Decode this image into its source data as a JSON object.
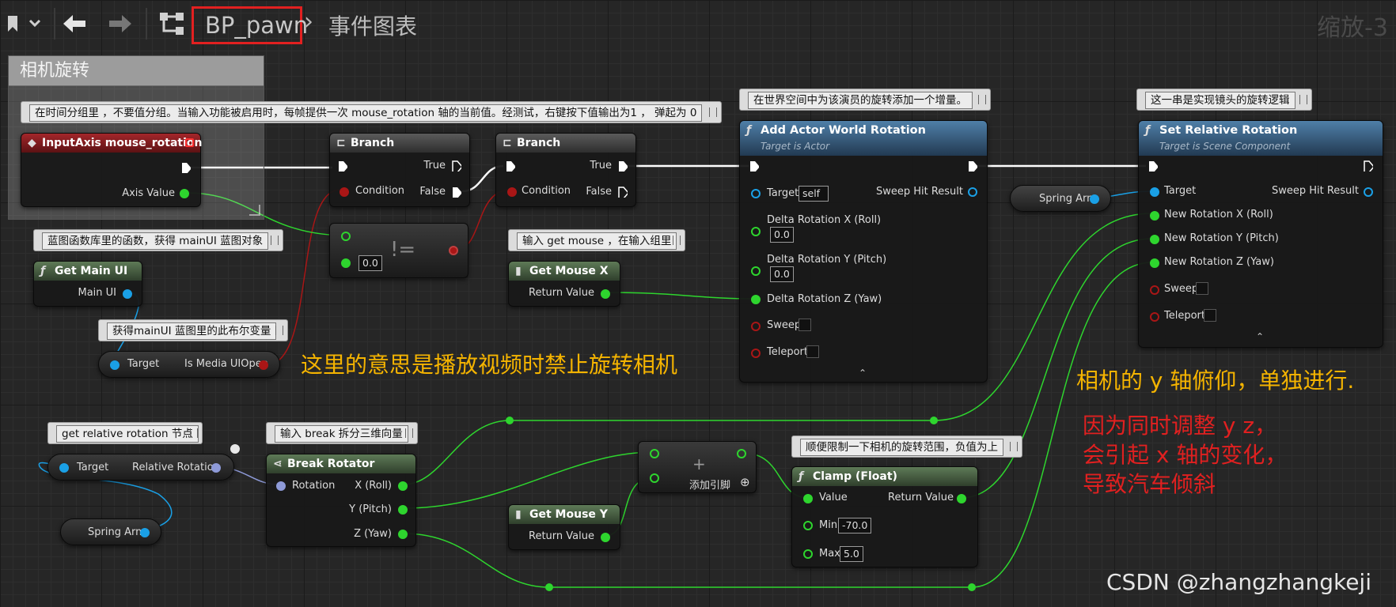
{
  "toolbar": {
    "graph_name": "BP_pawn",
    "graph_tab": "事件图表",
    "zoom": "缩放-3"
  },
  "comment_box": {
    "title": "相机旋转"
  },
  "comments": {
    "input_axis": "在时间分组里 ，不要值分组。当输入功能被启用时，每帧提供一次 mouse_rotation 轴的当前值。经测试，右键按下值输出为1 ， 弹起为 0",
    "get_main_ui": "蓝图函数库里的函数，获得 mainUI 蓝图对象",
    "is_media": "获得mainUI 蓝图里的此布尔变量",
    "get_mouse": "输入 get mouse ，在输入组里",
    "add_world_rotation": "在世界空间中为该演员的旋转添加一个增量。",
    "set_relative": "这一串是实现镜头的旋转逻辑",
    "get_relative": "get relative rotation 节点",
    "break_rotator": "输入 break 拆分三维向量",
    "clamp": "顺便限制一下相机的旋转范围，负值为上"
  },
  "nodes": {
    "input_axis": {
      "title": "InputAxis mouse_rotation",
      "axis_value": "Axis Value"
    },
    "branch1": {
      "title": "Branch",
      "true": "True",
      "false": "False",
      "condition": "Condition"
    },
    "branch2": {
      "title": "Branch",
      "true": "True",
      "false": "False",
      "condition": "Condition"
    },
    "not_equal": {
      "symbol": "!=",
      "value": "0.0"
    },
    "get_main_ui": {
      "title": "Get Main UI",
      "out": "Main UI"
    },
    "is_media": {
      "target": "Target",
      "out": "Is Media UIOpen"
    },
    "get_mouse_x": {
      "title": "Get Mouse X",
      "out": "Return Value"
    },
    "get_mouse_y": {
      "title": "Get Mouse Y",
      "out": "Return Value"
    },
    "add_world_rotation": {
      "title": "Add Actor World Rotation",
      "subtitle": "Target is Actor",
      "target": "Target",
      "target_value": "self",
      "sweep_hit": "Sweep Hit Result",
      "dx": "Delta Rotation X (Roll)",
      "dx_value": "0.0",
      "dy": "Delta Rotation Y (Pitch)",
      "dy_value": "0.0",
      "dz": "Delta Rotation Z (Yaw)",
      "sweep": "Sweep",
      "teleport": "Teleport"
    },
    "spring_arm_1": {
      "label": "Spring Arm"
    },
    "spring_arm_2": {
      "label": "Spring Arm"
    },
    "set_relative": {
      "title": "Set Relative Rotation",
      "subtitle": "Target is Scene Component",
      "target": "Target",
      "sweep_hit": "Sweep Hit Result",
      "nx": "New Rotation X (Roll)",
      "ny": "New Rotation Y (Pitch)",
      "nz": "New Rotation Z (Yaw)",
      "sweep": "Sweep",
      "teleport": "Teleport"
    },
    "get_relative": {
      "target": "Target",
      "out": "Relative Rotation"
    },
    "break_rotator": {
      "title": "Break Rotator",
      "in": "Rotation",
      "x": "X (Roll)",
      "y": "Y (Pitch)",
      "z": "Z (Yaw)"
    },
    "add": {
      "symbol": "+",
      "add_pin": "添加引脚"
    },
    "clamp": {
      "title": "Clamp (Float)",
      "value": "Value",
      "out": "Return Value",
      "min": "Min",
      "min_value": "-70.0",
      "max": "Max",
      "max_value": "5.0"
    }
  },
  "annotations": {
    "yellow1": "这里的意思是播放视频时禁止旋转相机",
    "yellow2": "相机的 y 轴俯仰，单独进行.",
    "red1": "因为同时调整 y z，",
    "red2": "会引起 x 轴的变化，",
    "red3": "导致汽车倾斜"
  },
  "watermark": "CSDN @zhangzhangkeji",
  "colors": {
    "exec_wire": "#ffffff",
    "float_wire": "#2ed52e",
    "bool_wire": "#a91616",
    "object_wire": "#1aa0e6",
    "highlight_box": "#e22020",
    "annotation_yellow": "#f5b400",
    "annotation_red": "#e02020"
  }
}
